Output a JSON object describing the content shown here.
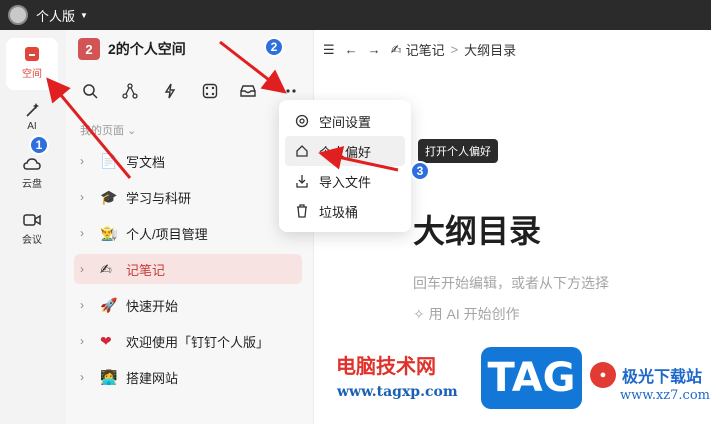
{
  "titlebar": {
    "app_name": "个人版"
  },
  "rail": {
    "items": [
      {
        "label": "空间",
        "icon": "space-icon"
      },
      {
        "label": "AI",
        "icon": "ai-spark-icon"
      },
      {
        "label": "云盘",
        "icon": "cloud-drive-icon"
      },
      {
        "label": "会议",
        "icon": "video-meeting-icon"
      }
    ]
  },
  "sidebar": {
    "space_badge": "2",
    "space_title": "2的个人空间",
    "tools": [
      "search-icon",
      "graph-icon",
      "lightning-icon",
      "dice-icon",
      "inbox-icon",
      "more-icon"
    ],
    "section_title": "我的页面 ⌄",
    "pages": [
      {
        "emoji": "📄",
        "label": "写文档"
      },
      {
        "emoji": "🎓",
        "label": "学习与科研"
      },
      {
        "emoji": "👨‍🌾",
        "label": "个人/项目管理"
      },
      {
        "emoji": "✍",
        "label": "记笔记"
      },
      {
        "emoji": "🚀",
        "label": "快速开始"
      },
      {
        "emoji": "❤",
        "label": "欢迎使用「钉钉个人版」"
      },
      {
        "emoji": "👩‍💻",
        "label": "搭建网站"
      }
    ]
  },
  "main": {
    "breadcrumb_parent": "记笔记",
    "breadcrumb_sep": ">",
    "breadcrumb_current": "大纲目录",
    "doc_title": "大纲目录",
    "hint": "回车开始编辑，或者从下方选择",
    "ai_text": "用 AI 开始创作"
  },
  "menu": {
    "items": [
      {
        "label": "空间设置",
        "icon": "settings-icon"
      },
      {
        "label": "个人偏好",
        "icon": "home-icon"
      },
      {
        "label": "导入文件",
        "icon": "import-icon"
      },
      {
        "label": "垃圾桶",
        "icon": "trash-icon"
      }
    ]
  },
  "tooltip": {
    "text": "打开个人偏好"
  },
  "annotations": {
    "step1": "1",
    "step2": "2",
    "step3": "3"
  },
  "watermark": {
    "site_cn": "电脑技术网",
    "url": "www.tagxp.com",
    "tag": "TAG",
    "brand_cn": "极光下载站",
    "brand_domain": "www.xz7.com"
  },
  "colors": {
    "accent_red": "#d25454",
    "annotation_blue": "#2e6fe0",
    "arrow_red": "#e02020"
  }
}
